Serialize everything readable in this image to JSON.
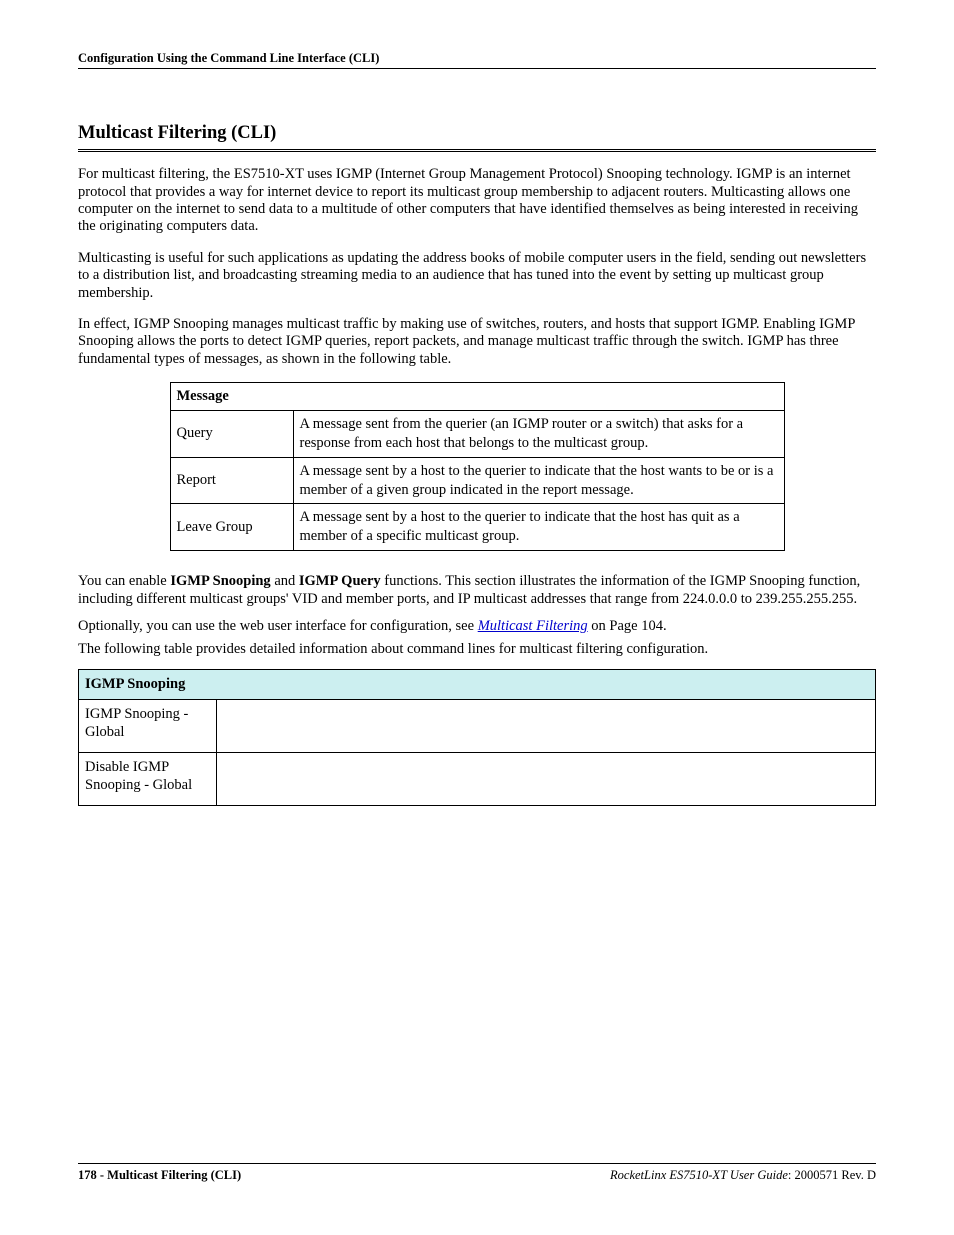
{
  "header": {
    "running_head": "Configuration Using the Command Line Interface (CLI)"
  },
  "title": "Multicast Filtering (CLI)",
  "paragraphs": {
    "p1": "For multicast filtering, the ES7510-XT uses IGMP (Internet Group Management Protocol) Snooping technology. IGMP is an internet protocol that provides a way for internet device to report its multicast group membership to adjacent routers. Multicasting allows one computer on the internet to send data to a multitude of other computers that have identified themselves as being interested in receiving the originating computers data.",
    "p2": "Multicasting is useful for such applications as updating the address books of mobile computer users in the field, sending out newsletters to a distribution list, and broadcasting streaming media to an audience that has tuned into the event by setting up multicast group membership.",
    "p3": "In effect, IGMP Snooping manages multicast traffic by making use of switches, routers, and hosts that support IGMP. Enabling IGMP Snooping allows the ports to detect IGMP queries, report packets, and manage multicast traffic through the switch. IGMP has three fundamental types of messages, as shown in the following table."
  },
  "msg_table": {
    "header": "Message",
    "rows": [
      {
        "name": "Query",
        "desc": "A message sent from the querier (an IGMP router or a switch) that asks for a response from each host that belongs to the multicast group."
      },
      {
        "name": "Report",
        "desc": "A message sent by a host to the querier to indicate that the host wants to be or is a member of a given group indicated in the report message."
      },
      {
        "name": "Leave Group",
        "desc": "A message sent by a host to the querier to indicate that the host has quit as a member of a specific multicast group."
      }
    ]
  },
  "post_table": {
    "p4_pre": "You can enable ",
    "p4_b1": "IGMP Snooping",
    "p4_mid1": " and ",
    "p4_b2": "IGMP Query",
    "p4_post": " functions. This section illustrates the information of the IGMP Snooping function, including different multicast groups' VID and member ports, and IP multicast addresses that range from 224.0.0.0 to 239.255.255.255.",
    "p5_pre": "Optionally, you can use the web user interface for configuration, see ",
    "p5_link": "Multicast Filtering",
    "p5_post": " on Page 104.",
    "p6": "The following table provides detailed information about command lines for multicast filtering configuration."
  },
  "igmp_table": {
    "header": "IGMP Snooping",
    "rows": [
      {
        "name": "IGMP Snooping - Global",
        "val": ""
      },
      {
        "name": "Disable IGMP Snooping - Global",
        "val": ""
      }
    ]
  },
  "footer": {
    "page_num": "178",
    "left_sep": " - ",
    "left_title": "Multicast Filtering (CLI)",
    "right_title": "RocketLinx ES7510-XT  User Guide",
    "right_sep": ": ",
    "right_rev": "2000571 Rev. D"
  }
}
